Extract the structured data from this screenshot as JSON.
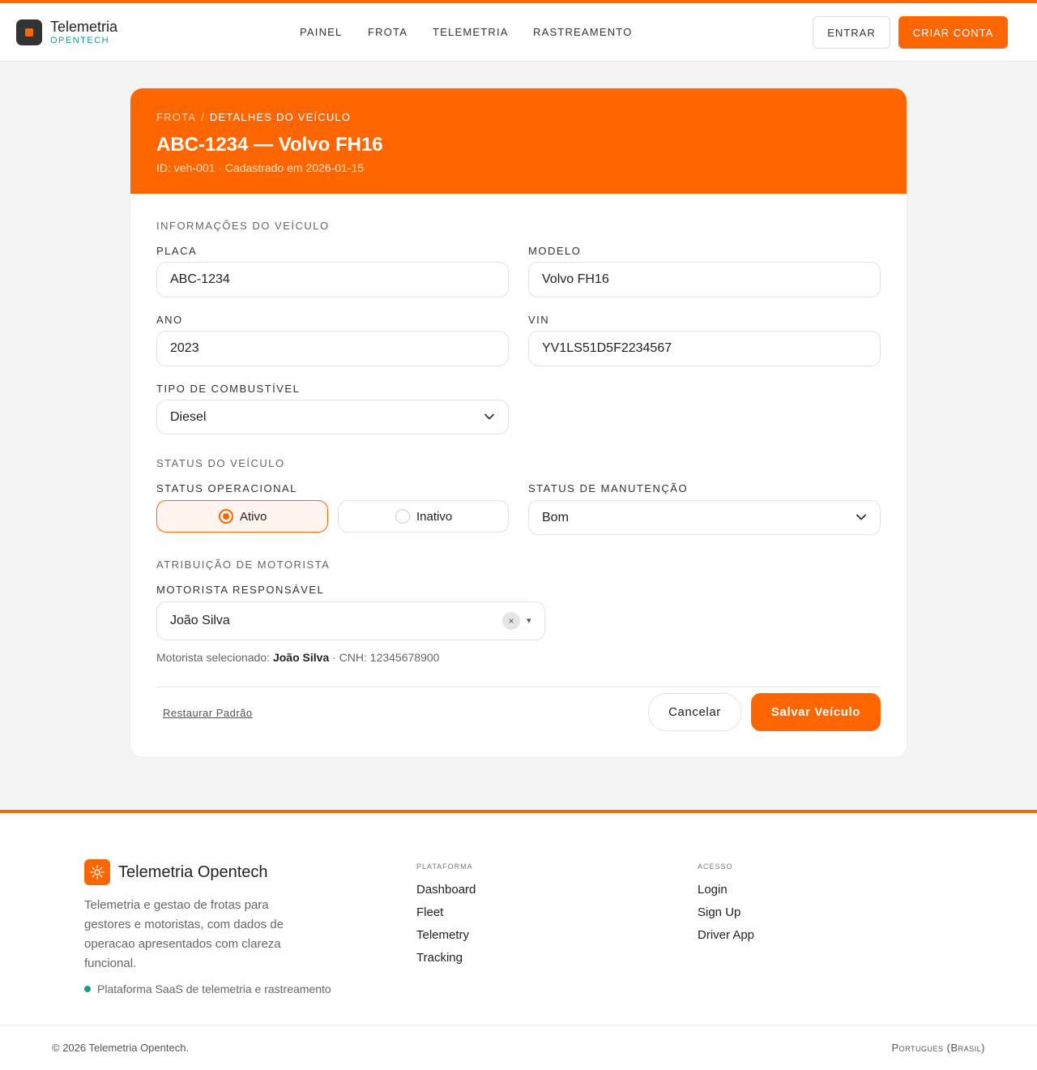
{
  "header": {
    "brand": "Telemetria",
    "brand_sub": "OPENTECH",
    "nav": [
      "PAINEL",
      "FROTA",
      "TELEMETRIA",
      "RASTREAMENTO"
    ],
    "login": "ENTRAR",
    "signup": "CRIAR CONTA"
  },
  "card": {
    "breadcrumb": [
      "FROTA",
      "DETALHES DO VEÍCULO"
    ],
    "breadcrumb_sep": "/",
    "title": "ABC-1234 — Volvo FH16",
    "meta": "ID: veh-001 · Cadastrado em 2026-01-15"
  },
  "vehicle_info": {
    "section": "INFORMAÇÕES DO VEÍCULO",
    "plate_label": "PLACA",
    "plate_value": "ABC-1234",
    "model_label": "MODELO",
    "model_value": "Volvo FH16",
    "year_label": "ANO",
    "year_value": "2023",
    "vin_label": "VIN",
    "vin_value": "YV1LS51D5F2234567",
    "fuel_label": "TIPO DE COMBUSTÍVEL",
    "fuel_value": "Diesel"
  },
  "vehicle_status": {
    "section": "STATUS DO VEÍCULO",
    "operational_label": "STATUS OPERACIONAL",
    "options": [
      "Ativo",
      "Inativo"
    ],
    "selected": "Ativo",
    "maintenance_label": "STATUS DE MANUTENÇÃO",
    "maintenance_value": "Bom"
  },
  "driver": {
    "section": "ATRIBUIÇÃO DE MOTORISTA",
    "label": "MOTORISTA RESPONSÁVEL",
    "value": "João Silva",
    "clear_icon": "×",
    "caret_icon": "▾",
    "selected_prefix": "Motorista selecionado:",
    "selected_name": "João Silva",
    "selected_suffix": "· CNH: 12345678900"
  },
  "actions": {
    "reset": "Restaurar Padrão",
    "cancel": "Cancelar",
    "save": "Salvar Veículo"
  },
  "footer": {
    "brand": "Telemetria Opentech",
    "description": "Telemetria e gestao de frotas para gestores e motoristas, com dados de operacao apresentados com clareza funcional.",
    "status": "Plataforma SaaS de telemetria e rastreamento",
    "platform_title": "PLATAFORMA",
    "platform_links": [
      "Dashboard",
      "Fleet",
      "Telemetry",
      "Tracking"
    ],
    "access_title": "ACESSO",
    "access_links": [
      "Login",
      "Sign Up",
      "Driver App"
    ],
    "copyright": "© 2026 Telemetria Opentech.",
    "language": "Portugues (Brasil)"
  },
  "colors": {
    "accent": "#ff6600",
    "teal": "#0f9f8a"
  }
}
